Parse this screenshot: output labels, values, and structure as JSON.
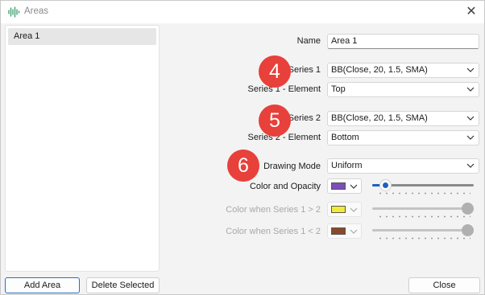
{
  "window": {
    "title": "Areas",
    "icon": "waveform-icon"
  },
  "areas": {
    "items": [
      "Area 1"
    ]
  },
  "buttons": {
    "add": "Add Area",
    "delete": "Delete Selected",
    "close": "Close"
  },
  "form": {
    "name_label": "Name",
    "name_value": "Area 1",
    "series1_label": "Series 1",
    "series1_value": "BB(Close, 20, 1.5, SMA)",
    "series1_element_label": "Series 1 - Element",
    "series1_element_value": "Top",
    "series2_label": "Series 2",
    "series2_value": "BB(Close, 20, 1.5, SMA)",
    "series2_element_label": "Series 2 - Element",
    "series2_element_value": "Bottom",
    "drawing_mode_label": "Drawing Mode",
    "drawing_mode_value": "Uniform",
    "color_opacity_label": "Color and Opacity",
    "color_opacity_swatch": "#7b4fb8",
    "color_opacity_level": 0.1,
    "color_gt_label": "Color when Series 1 > 2",
    "color_gt_swatch": "#f2ea3a",
    "color_gt_level": 1.0,
    "color_lt_label": "Color when Series 1 < 2",
    "color_lt_swatch": "#8a4a2a",
    "color_lt_level": 1.0
  },
  "badges": [
    "4",
    "5",
    "6"
  ],
  "colors": {
    "accent": "#1a63c3",
    "badge": "#e8403a",
    "selection": "#e6e6e6"
  }
}
